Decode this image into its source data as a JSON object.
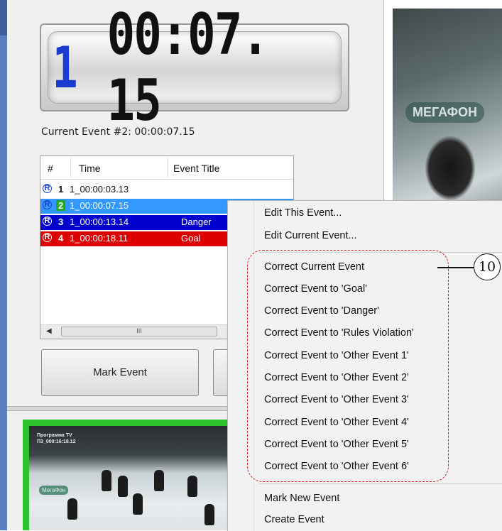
{
  "timer": {
    "event_number": "1",
    "time": "00:07. 15"
  },
  "current_event_text": "Current Event #2: 00:00:07.15",
  "list": {
    "columns": [
      "#",
      "Time",
      "Event Title"
    ],
    "rows": [
      {
        "marker": "R",
        "num": "1",
        "time": "1_00:00:03.13",
        "title": "",
        "row_bg": "#ffffff",
        "text_color": "#111111",
        "num_bg": "",
        "marker_color": "#1a3cd0"
      },
      {
        "marker": "R",
        "num": "2",
        "time": "1_00:00:07.15",
        "title": "",
        "row_bg": "#3399ff",
        "text_color": "#ffffff",
        "num_bg": "#22a822",
        "marker_color": "#1a3cd0"
      },
      {
        "marker": "R",
        "num": "3",
        "time": "1_00:00:13.14",
        "title": "Danger",
        "row_bg": "#0000cc",
        "text_color": "#ffffff",
        "num_bg": "",
        "marker_color": "#ffffff"
      },
      {
        "marker": "R",
        "num": "4",
        "time": "1_00:00:18.11",
        "title": "Goal",
        "row_bg": "#dd0000",
        "text_color": "#ffffff",
        "num_bg": "",
        "marker_color": "#ffffff"
      }
    ],
    "scroll_thumb_label": "III"
  },
  "buttons": {
    "mark_event": "Mark Event"
  },
  "video_top": {
    "logo_text": "МЕГАФОН"
  },
  "video_bottom": {
    "overlay_line1": "Программа TV",
    "overlay_line2": "П3_000:16:18.12",
    "logo_text": "МегаФон"
  },
  "context_menu": {
    "items_top": [
      "Edit This Event...",
      "Edit Current Event..."
    ],
    "items_correct": [
      "Correct Current Event",
      "Correct Event to 'Goal'",
      "Correct Event to 'Danger'",
      "Correct Event to 'Rules Violation'",
      "Correct Event to 'Other Event 1'",
      "Correct Event to 'Other Event 2'",
      "Correct Event to 'Other Event 3'",
      "Correct Event to 'Other Event 4'",
      "Correct Event to 'Other Event 5'",
      "Correct Event to 'Other Event 6'"
    ],
    "items_bottom": [
      "Mark New Event",
      "Create Event"
    ]
  },
  "callout_number": "10",
  "colors": {
    "selection_blue": "#3399ff",
    "danger_blue": "#0000cc",
    "goal_red": "#dd0000",
    "highlight_green": "#2ec22e",
    "dash_red": "#d82020"
  }
}
